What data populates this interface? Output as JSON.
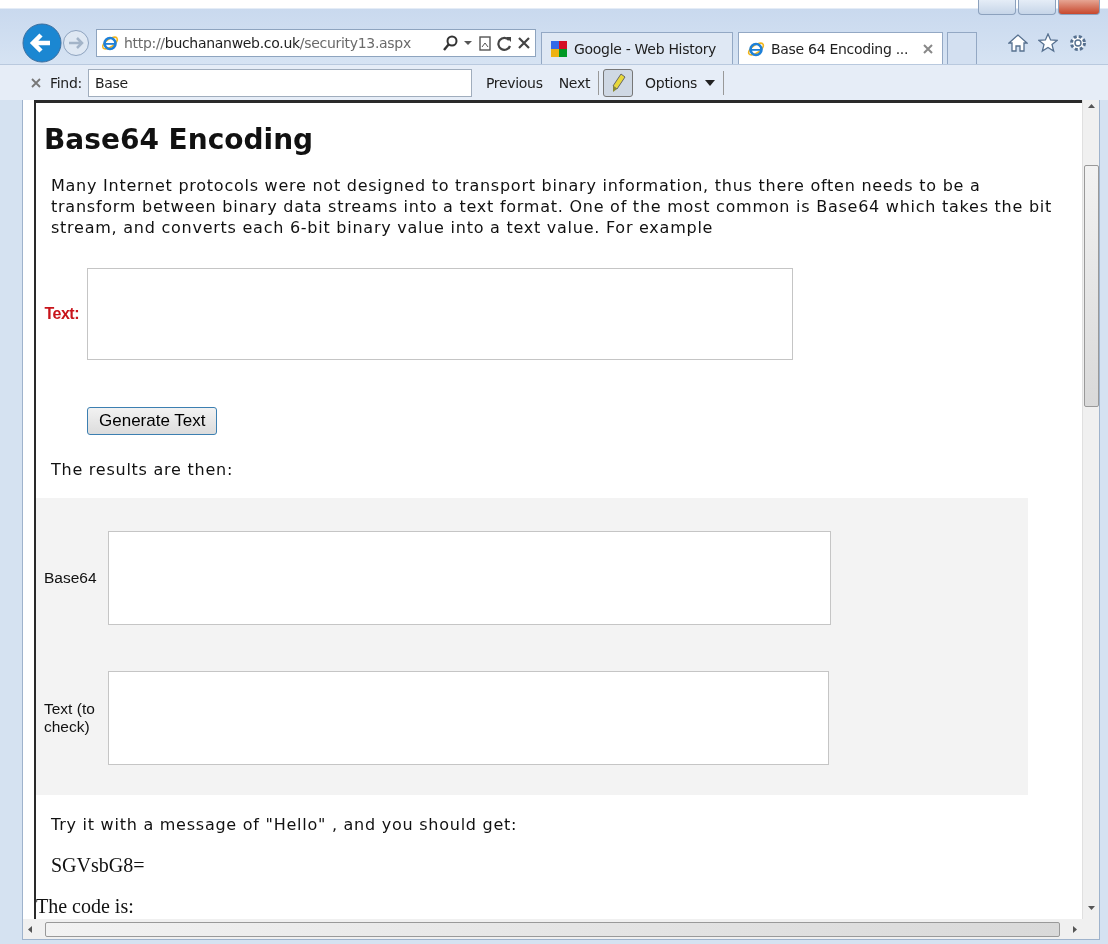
{
  "browser": {
    "address": {
      "scheme": "http://",
      "host": "buchananweb.co.uk",
      "path": "/security13.aspx"
    },
    "tabs": [
      {
        "title": "Google - Web History",
        "selected": false,
        "kind": "google"
      },
      {
        "title": "Base 64 Encoding ...",
        "selected": true,
        "kind": "ie"
      }
    ]
  },
  "find_bar": {
    "label": "Find:",
    "value": "Base",
    "buttons": [
      "Previous",
      "Next"
    ],
    "highlight_pressed": true,
    "options": "Options"
  },
  "page": {
    "title": "Base64 Encoding",
    "intro": "Many Internet protocols were not designed to transport binary information, thus there often needs to be a transform between binary data streams into a text format. One of the most common is Base64 which takes the bit stream, and converts each 6-bit binary value into a text value. For example",
    "input_label": "Text:",
    "button": "Generate Text",
    "results_intro": "The results are then:",
    "results": [
      {
        "label": "Base64"
      },
      {
        "label": "Text (to check)"
      }
    ],
    "try_text": "Try it with a message of \"Hello\" , and you should get:",
    "example_output": "SGVsbG8=",
    "code_heading": "The code is:"
  }
}
